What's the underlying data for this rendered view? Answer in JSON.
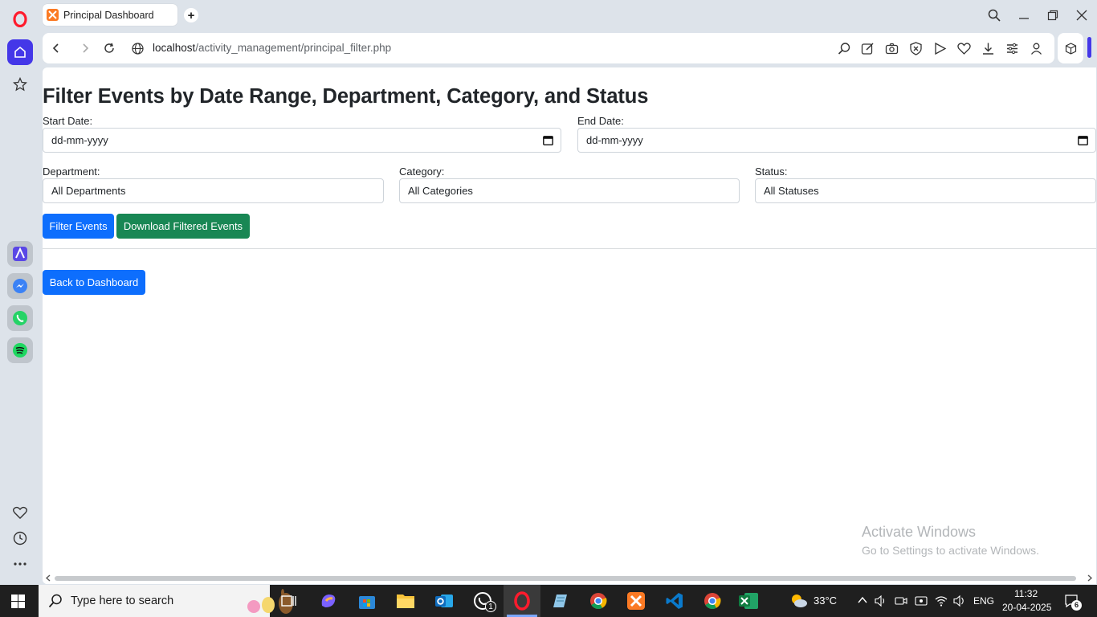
{
  "browser": {
    "tab_title": "Principal Dashboard",
    "url_host": "localhost",
    "url_path": "/activity_management/principal_filter.php"
  },
  "page": {
    "heading": "Filter Events by Date Range, Department, Category, and Status",
    "start_date": {
      "label": "Start Date:",
      "value": "dd-mm-yyyy"
    },
    "end_date": {
      "label": "End Date:",
      "value": "dd-mm-yyyy"
    },
    "department": {
      "label": "Department:",
      "value": "All Departments"
    },
    "category": {
      "label": "Category:",
      "value": "All Categories"
    },
    "status": {
      "label": "Status:",
      "value": "All Statuses"
    },
    "filter_button": "Filter Events",
    "download_button": "Download Filtered Events",
    "back_button": "Back to Dashboard",
    "watermark_title": "Activate Windows",
    "watermark_sub": "Go to Settings to activate Windows."
  },
  "taskbar": {
    "search_placeholder": "Type here to search",
    "weather": "33°C",
    "language": "ENG",
    "time": "11:32",
    "date": "20-04-2025",
    "notifications": "6",
    "whatsapp_badge": "1"
  },
  "colors": {
    "primary": "#0d6efd",
    "success": "#198754",
    "opera_red": "#ff1b2d",
    "sidebar_active": "#4437e8"
  }
}
